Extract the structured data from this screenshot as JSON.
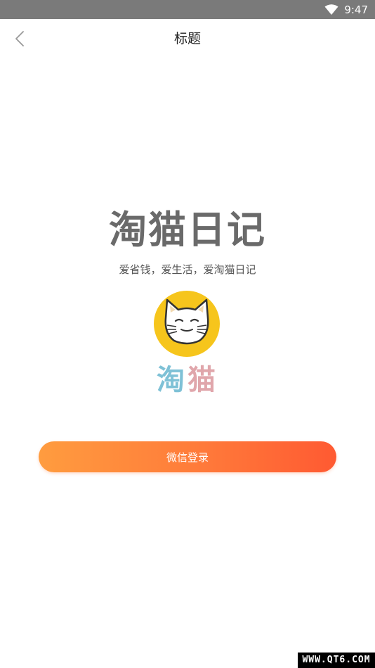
{
  "status_bar": {
    "time": "9:47",
    "wifi_icon": "wifi-icon"
  },
  "nav": {
    "back_icon": "chevron-left-icon",
    "title": "标题"
  },
  "main": {
    "app_name": "淘猫日记",
    "slogan": "爱省钱，爱生活，爱淘猫日记",
    "logo": {
      "icon": "cat-face-icon",
      "text_char_1": "淘",
      "text_char_2": "猫",
      "colors": {
        "circle": "#f6c51c",
        "char_1": "#7ec1d6",
        "char_2": "#e0a6ab"
      }
    },
    "login_button_label": "微信登录"
  },
  "watermark": "WWW.QT6.COM",
  "colors": {
    "status_bar_bg": "#7a7a7a",
    "button_gradient_start": "#ff9c3f",
    "button_gradient_end": "#ff5a32",
    "app_name": "#6a6a6a"
  }
}
